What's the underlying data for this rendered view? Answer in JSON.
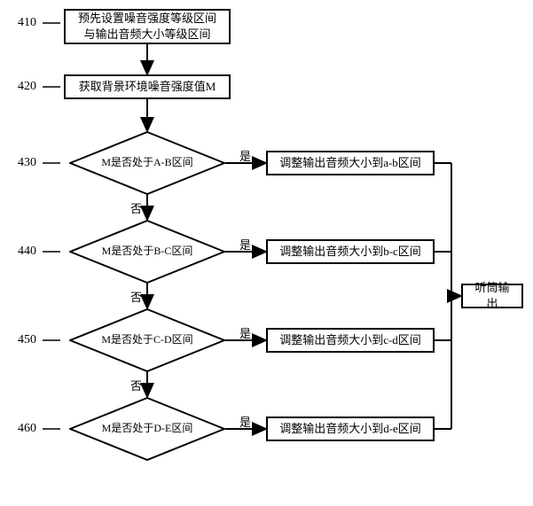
{
  "refs": {
    "r410": "410",
    "r420": "420",
    "r430": "430",
    "r440": "440",
    "r450": "450",
    "r460": "460"
  },
  "boxes": {
    "b410": "预先设置噪音强度等级区间\n与输出音频大小等级区间",
    "b420": "获取背景环境噪音强度值M",
    "out1": "调整输出音频大小到a-b区间",
    "out2": "调整输出音频大小到b-c区间",
    "out3": "调整输出音频大小到c-d区间",
    "out4": "调整输出音频大小到d-e区间",
    "final": "听筒输出"
  },
  "diamonds": {
    "d430": "M是否处于A-B区间",
    "d440": "M是否处于B-C区间",
    "d450": "M是否处于C-D区间",
    "d460": "M是否处于D-E区间"
  },
  "labels": {
    "yes": "是",
    "no": "否"
  }
}
